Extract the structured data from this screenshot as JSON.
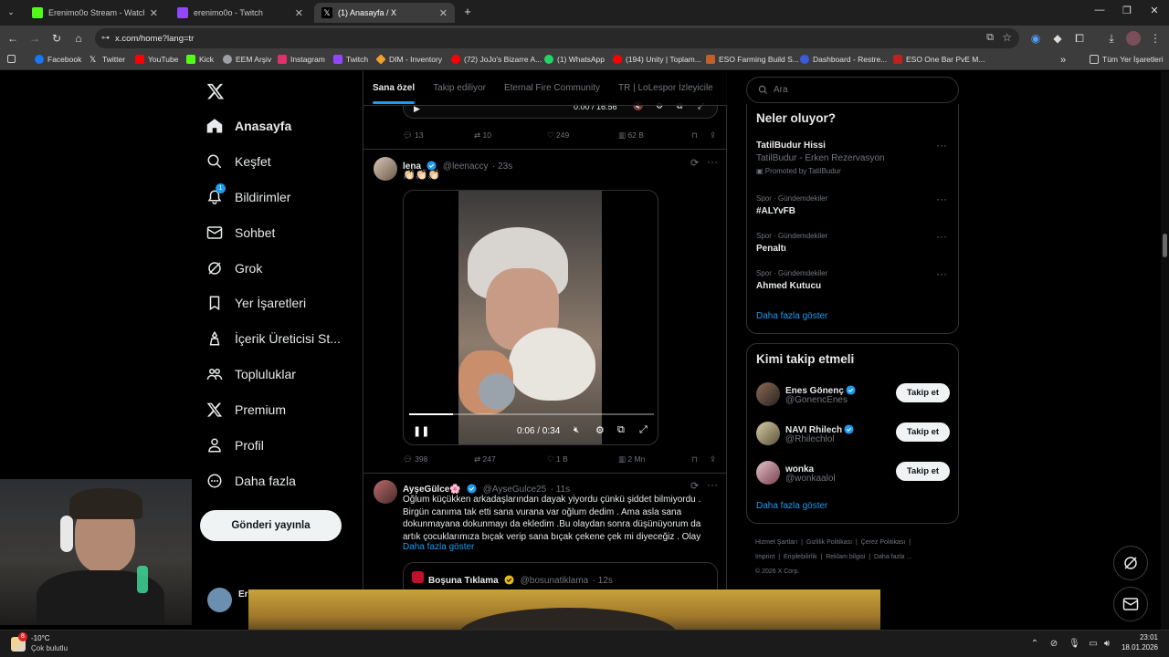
{
  "browser": {
    "tabs": [
      {
        "title": "Erenimo0o Stream - Watch Live",
        "active": false,
        "favicon_color": "#53fc18"
      },
      {
        "title": "erenimo0o - Twitch",
        "active": false,
        "favicon_color": "#9146ff"
      },
      {
        "title": "(1) Anasayfa / X",
        "active": true,
        "favicon_color": "#000000"
      }
    ],
    "url": "x.com/home?lang=tr",
    "bookmarks": [
      {
        "label": "Facebook",
        "color": "#1877f2"
      },
      {
        "label": "Twitter",
        "color": "#ffffff"
      },
      {
        "label": "YouTube",
        "color": "#ff0000"
      },
      {
        "label": "Kick",
        "color": "#53fc18"
      },
      {
        "label": "EEM Arşiv",
        "color": "#9aa0a6"
      },
      {
        "label": "Instagram",
        "color": "#e1306c"
      },
      {
        "label": "Twitch",
        "color": "#9146ff"
      },
      {
        "label": "DIM - Inventory",
        "color": "#f0a030"
      },
      {
        "label": "(72) JoJo's Bizarre A...",
        "color": "#ff0000"
      },
      {
        "label": "(1) WhatsApp",
        "color": "#25d366"
      },
      {
        "label": "(194) Unity | Toplam...",
        "color": "#ff0000"
      },
      {
        "label": "ESO Farming Build S...",
        "color": "#c0602a"
      },
      {
        "label": "Dashboard - Restre...",
        "color": "#3b5bdb"
      },
      {
        "label": "ESO One Bar PvE M...",
        "color": "#c02020"
      }
    ],
    "all_bookmarks": "Tüm Yer İşaretleri"
  },
  "sidebar": {
    "items": [
      {
        "label": "Anasayfa",
        "icon": "home-icon"
      },
      {
        "label": "Keşfet",
        "icon": "search-icon"
      },
      {
        "label": "Bildirimler",
        "icon": "bell-icon",
        "badge": "1"
      },
      {
        "label": "Sohbet",
        "icon": "mail-icon"
      },
      {
        "label": "Grok",
        "icon": "grok-icon"
      },
      {
        "label": "Yer İşaretleri",
        "icon": "bookmark-icon"
      },
      {
        "label": "İçerik Üreticisi St...",
        "icon": "creator-icon"
      },
      {
        "label": "Topluluklar",
        "icon": "communities-icon"
      },
      {
        "label": "Premium",
        "icon": "x-premium-icon"
      },
      {
        "label": "Profil",
        "icon": "profile-icon"
      },
      {
        "label": "Daha fazla",
        "icon": "more-circle-icon"
      }
    ],
    "post_button": "Gönderi yayınla",
    "account_name": "Er"
  },
  "feed": {
    "tabs": [
      "Sana özel",
      "Takip ediliyor",
      "Eternal Fire Community",
      "TR | LoLespor İzleyicile"
    ],
    "prev_post": {
      "video_time": "0:00 / 16:56",
      "replies": "13",
      "reposts": "10",
      "likes": "249",
      "views": "62 B"
    },
    "post1": {
      "name": "lena",
      "handle": "@leenaccy",
      "time": "· 23s",
      "text": "👏🏻👏🏻👏🏻",
      "video_time": "0:06 / 0:34",
      "video_progress": 0.18,
      "replies": "398",
      "reposts": "247",
      "likes": "1 B",
      "views": "2 Mn"
    },
    "post2": {
      "name": "AyşeGülce🌸",
      "handle": "@AyseGulce25",
      "time": "· 11s",
      "text": "Oğlum küçükken arkadaşlarından dayak yiyordu çünkü şiddet bilmiyordu . Birgün canıma tak etti sana vurana var oğlum dedim . Ama asla sana dokunmayana dokunmayı da ekledim .Bu olaydan sonra düşünüyorum da artık çocuklarımıza bıçak verip sana bıçak çekene çek mi diyeceğiz . Olay",
      "show_more": "Daha fazla göster",
      "quote": {
        "name": "Boşuna Tıklama",
        "handle": "@bosunatiklama",
        "time": "· 12s"
      }
    }
  },
  "right": {
    "search_placeholder": "Ara",
    "trends_title": "Neler oluyor?",
    "trends": [
      {
        "meta": "",
        "name": "TatilBudur Hissi",
        "sub": "TatilBudur - Erken Rezervasyon",
        "promoted": "Promoted by TatilBudur"
      },
      {
        "meta": "Spor · Gündemdekiler",
        "name": "#ALYvFB"
      },
      {
        "meta": "Spor · Gündemdekiler",
        "name": "Penaltı"
      },
      {
        "meta": "Spor · Gündemdekiler",
        "name": "Ahmed Kutucu"
      }
    ],
    "trends_more": "Daha fazla göster",
    "who_title": "Kimi takip etmeli",
    "who": [
      {
        "name": "Enes Gönenç",
        "handle": "@GonencEnes",
        "button": "Takip et"
      },
      {
        "name": "NAVI Rhilech",
        "handle": "@Rhilechlol",
        "button": "Takip et"
      },
      {
        "name": "wonka",
        "handle": "@wonkaalol",
        "button": "Takip et"
      }
    ],
    "who_more": "Daha fazla göster",
    "footer": [
      "Hizmet Şartları",
      "Gizlilik Politikası",
      "Çerez Politikası",
      "Imprint",
      "Erişilebilirlik",
      "Reklam bilgisi",
      "Daha fazla ...",
      "© 2026 X Corp."
    ]
  },
  "taskbar": {
    "weather_temp": "-10°C",
    "weather_desc": "Çok bulutlu",
    "weather_badge": "8",
    "time": "23:01",
    "date": "18.01.2026"
  },
  "colors": {
    "accent": "#1d9bf0",
    "background": "#000000",
    "border": "#2f3336",
    "muted": "#71767b"
  }
}
